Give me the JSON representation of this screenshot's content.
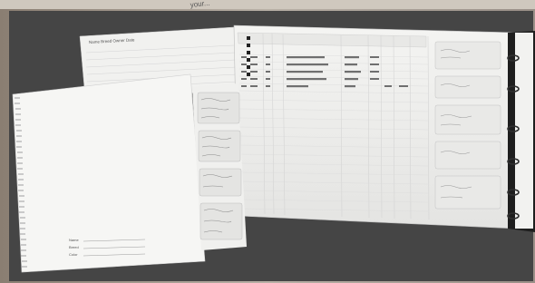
{
  "image": {
    "alt": "Photograph of printed record-book pages: a spiral-bound notebook page and a large ring-binder ledger spread with rows of entries, laid on a dark grey surface.",
    "background_color": "#454545",
    "frame_color": "#d8d2c8"
  },
  "top_strip": {
    "text": "your..."
  },
  "binder": {
    "header_text": "Name  Breed  Owner  Date",
    "tab_labels": [
      "A",
      "B",
      "C",
      "D",
      "E",
      "F"
    ]
  },
  "spiral_page": {
    "footer_lines": [
      "Name",
      "Breed",
      "Color"
    ]
  }
}
